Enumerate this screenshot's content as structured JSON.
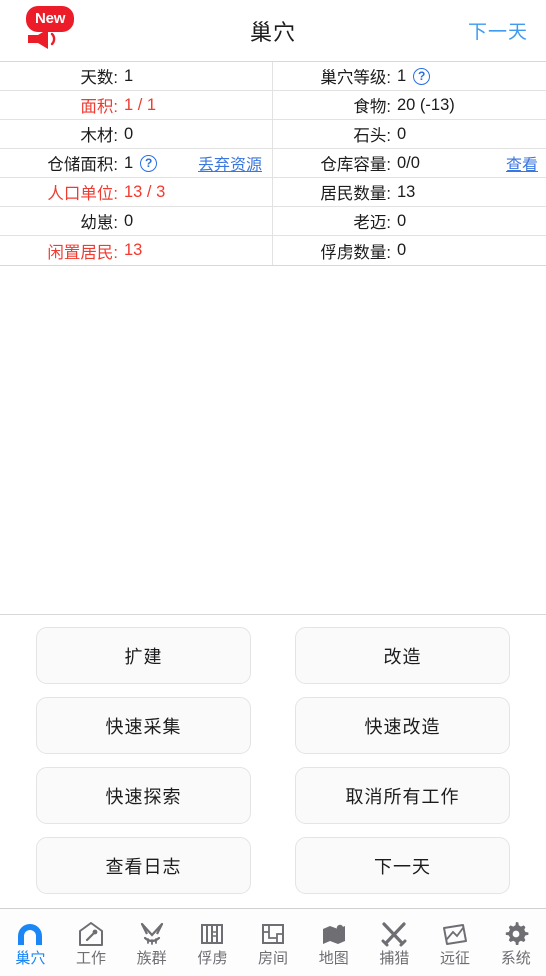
{
  "header": {
    "badge_text": "New",
    "badge_icon": "megaphone-icon",
    "title": "巢穴",
    "action_label": "下一天"
  },
  "stats": {
    "rows": [
      {
        "left": {
          "label": "天数:",
          "value": "1",
          "red": false,
          "help": false,
          "link": null
        },
        "right": {
          "label": "巢穴等级:",
          "value": "1",
          "red": false,
          "help": true,
          "link": null
        }
      },
      {
        "left": {
          "label": "面积:",
          "value": "1 / 1",
          "red": true,
          "help": false,
          "link": null
        },
        "right": {
          "label": "食物:",
          "value": "20 (-13)",
          "red": false,
          "help": false,
          "link": null
        }
      },
      {
        "left": {
          "label": "木材:",
          "value": "0",
          "red": false,
          "help": false,
          "link": null
        },
        "right": {
          "label": "石头:",
          "value": "0",
          "red": false,
          "help": false,
          "link": null
        }
      },
      {
        "left": {
          "label": "仓储面积:",
          "value": "1",
          "red": false,
          "help": true,
          "link": "丢弃资源"
        },
        "right": {
          "label": "仓库容量:",
          "value": "0/0",
          "red": false,
          "help": false,
          "link": "查看"
        }
      },
      {
        "left": {
          "label": "人口单位:",
          "value": "13 / 3",
          "red": true,
          "help": false,
          "link": null
        },
        "right": {
          "label": "居民数量:",
          "value": "13",
          "red": false,
          "help": false,
          "link": null
        }
      },
      {
        "left": {
          "label": "幼崽:",
          "value": "0",
          "red": false,
          "help": false,
          "link": null
        },
        "right": {
          "label": "老迈:",
          "value": "0",
          "red": false,
          "help": false,
          "link": null
        }
      },
      {
        "left": {
          "label": "闲置居民:",
          "value": "13",
          "red": true,
          "help": false,
          "link": null
        },
        "right": {
          "label": "俘虏数量:",
          "value": "0",
          "red": false,
          "help": false,
          "link": null
        }
      }
    ],
    "help_glyph": "?"
  },
  "actions": {
    "buttons": [
      {
        "label": "扩建"
      },
      {
        "label": "改造"
      },
      {
        "label": "快速采集"
      },
      {
        "label": "快速改造"
      },
      {
        "label": "快速探索"
      },
      {
        "label": "取消所有工作"
      },
      {
        "label": "查看日志"
      },
      {
        "label": "下一天"
      }
    ]
  },
  "tabbar": {
    "active_index": 0,
    "tabs": [
      {
        "label": "巢穴",
        "icon": "cave-icon"
      },
      {
        "label": "工作",
        "icon": "workshop-house-icon"
      },
      {
        "label": "族群",
        "icon": "tribe-mask-icon"
      },
      {
        "label": "俘虏",
        "icon": "prison-bars-icon"
      },
      {
        "label": "房间",
        "icon": "floorplan-icon"
      },
      {
        "label": "地图",
        "icon": "map-pin-icon"
      },
      {
        "label": "捕猎",
        "icon": "crossed-swords-icon"
      },
      {
        "label": "远征",
        "icon": "expedition-banner-icon"
      },
      {
        "label": "系统",
        "icon": "gear-icon"
      }
    ]
  },
  "colors": {
    "accent_blue": "#1b86f5",
    "link_blue": "#3a76e0",
    "header_action_blue": "#3e9bf0",
    "alert_red": "#ef3b30",
    "badge_red": "#ec1c28",
    "text": "#1c1c1e",
    "tab_inactive": "#6e6e73"
  }
}
